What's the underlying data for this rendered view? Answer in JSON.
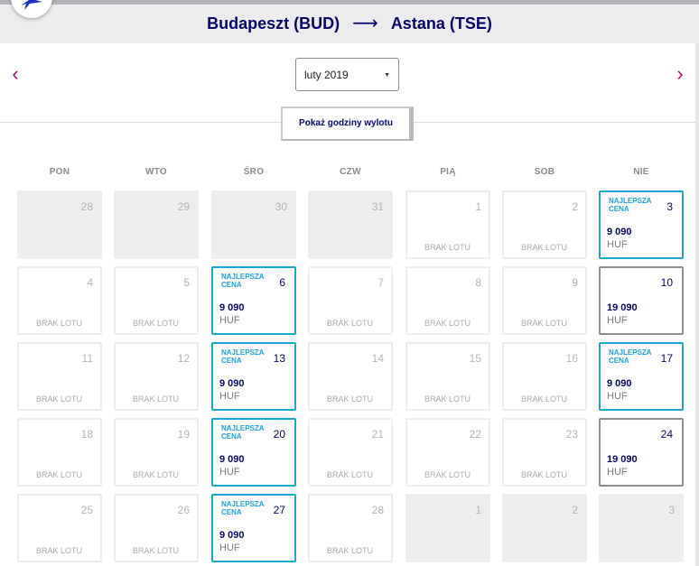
{
  "header": {
    "origin": "Budapeszt (BUD)",
    "arrow": "⟶",
    "destination": "Astana (TSE)"
  },
  "nav": {
    "prev_icon": "chevron-left-icon",
    "next_icon": "chevron-right-icon",
    "prev_glyph": "‹",
    "next_glyph": "›"
  },
  "month_select": {
    "value": "luty 2019",
    "caret": "▼"
  },
  "hours_button": {
    "label": "Pokaż godziny wylotu"
  },
  "weekdays": [
    "PON",
    "WTO",
    "ŚRO",
    "CZW",
    "PIĄ",
    "SOB",
    "NIE"
  ],
  "colors": {
    "navy": "#06056b",
    "cyan": "#1ba5d6",
    "accent": "#c6007e"
  },
  "calendar": {
    "weeks": [
      [
        {
          "day": "28",
          "state": "past"
        },
        {
          "day": "29",
          "state": "past"
        },
        {
          "day": "30",
          "state": "past"
        },
        {
          "day": "31",
          "state": "past"
        },
        {
          "day": "1",
          "state": "nolot",
          "status": "BRAK LOTU"
        },
        {
          "day": "2",
          "state": "nolot",
          "status": "BRAK LOTU"
        },
        {
          "day": "3",
          "state": "best",
          "badge": "NAJLEPSZA CENA",
          "price": "9 090",
          "currency": "HUF"
        }
      ],
      [
        {
          "day": "4",
          "state": "nolot",
          "status": "BRAK LOTU"
        },
        {
          "day": "5",
          "state": "nolot",
          "status": "BRAK LOTU"
        },
        {
          "day": "6",
          "state": "best",
          "badge": "NAJLEPSZA CENA",
          "price": "9 090",
          "currency": "HUF"
        },
        {
          "day": "7",
          "state": "nolot",
          "status": "BRAK LOTU"
        },
        {
          "day": "8",
          "state": "nolot",
          "status": "BRAK LOTU"
        },
        {
          "day": "9",
          "state": "nolot",
          "status": "BRAK LOTU"
        },
        {
          "day": "10",
          "state": "std",
          "price": "19 090",
          "currency": "HUF"
        }
      ],
      [
        {
          "day": "11",
          "state": "nolot",
          "status": "BRAK LOTU"
        },
        {
          "day": "12",
          "state": "nolot",
          "status": "BRAK LOTU"
        },
        {
          "day": "13",
          "state": "best",
          "badge": "NAJLEPSZA CENA",
          "price": "9 090",
          "currency": "HUF"
        },
        {
          "day": "14",
          "state": "nolot",
          "status": "BRAK LOTU"
        },
        {
          "day": "15",
          "state": "nolot",
          "status": "BRAK LOTU"
        },
        {
          "day": "16",
          "state": "nolot",
          "status": "BRAK LOTU"
        },
        {
          "day": "17",
          "state": "best",
          "badge": "NAJLEPSZA CENA",
          "price": "9 090",
          "currency": "HUF"
        }
      ],
      [
        {
          "day": "18",
          "state": "nolot",
          "status": "BRAK LOTU"
        },
        {
          "day": "19",
          "state": "nolot",
          "status": "BRAK LOTU"
        },
        {
          "day": "20",
          "state": "best",
          "badge": "NAJLEPSZA CENA",
          "price": "9 090",
          "currency": "HUF"
        },
        {
          "day": "21",
          "state": "nolot",
          "status": "BRAK LOTU"
        },
        {
          "day": "22",
          "state": "nolot",
          "status": "BRAK LOTU"
        },
        {
          "day": "23",
          "state": "nolot",
          "status": "BRAK LOTU"
        },
        {
          "day": "24",
          "state": "std",
          "price": "19 090",
          "currency": "HUF"
        }
      ],
      [
        {
          "day": "25",
          "state": "nolot",
          "status": "BRAK LOTU"
        },
        {
          "day": "26",
          "state": "nolot",
          "status": "BRAK LOTU"
        },
        {
          "day": "27",
          "state": "best",
          "badge": "NAJLEPSZA CENA",
          "price": "9 090",
          "currency": "HUF"
        },
        {
          "day": "28",
          "state": "nolot",
          "status": "BRAK LOTU"
        },
        {
          "day": "1",
          "state": "past"
        },
        {
          "day": "2",
          "state": "past"
        },
        {
          "day": "3",
          "state": "past"
        }
      ]
    ]
  }
}
